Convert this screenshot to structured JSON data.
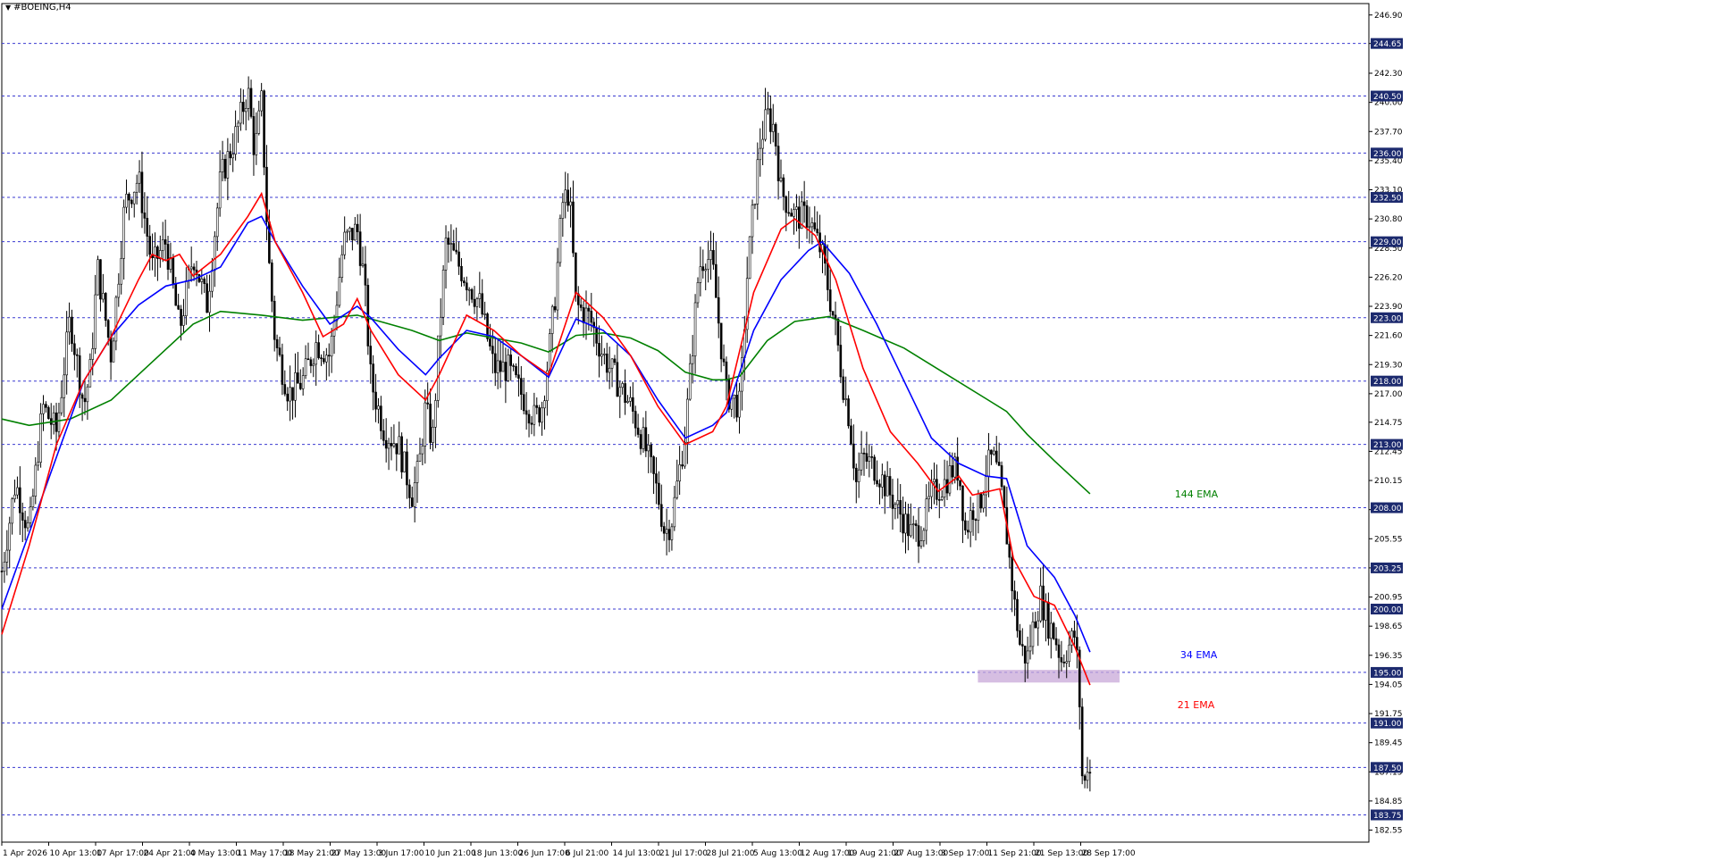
{
  "window": {
    "symbol_title": "#BOEING,H4",
    "menu_icon": "triangle-down-icon"
  },
  "chart_data": {
    "type": "candlestick",
    "title": "#BOEING,H4",
    "ylim": [
      181.6,
      247.8
    ],
    "y_ticks": [
      "246.90",
      "244.65",
      "242.30",
      "240.00",
      "237.70",
      "235.40",
      "233.10",
      "230.80",
      "228.50",
      "226.20",
      "223.90",
      "221.60",
      "219.30",
      "217.00",
      "214.75",
      "212.45",
      "210.15",
      "207.85",
      "205.55",
      "203.25",
      "200.95",
      "198.65",
      "196.35",
      "194.05",
      "191.75",
      "189.45",
      "187.15",
      "184.85",
      "182.55"
    ],
    "x_ticks": [
      "1 Apr 2026",
      "10 Apr 13:00",
      "17 Apr 17:00",
      "24 Apr 21:00",
      "4 May 13:00",
      "11 May 17:00",
      "18 May 21:00",
      "27 May 13:00",
      "3 Jun 17:00",
      "10 Jun 21:00",
      "18 Jun 13:00",
      "26 Jun 17:00",
      "6 Jul 21:00",
      "14 Jul 13:00",
      "21 Jul 17:00",
      "28 Jul 21:00",
      "5 Aug 13:00",
      "12 Aug 17:00",
      "19 Aug 21:00",
      "27 Aug 13:00",
      "3 Sep 17:00",
      "11 Sep 21:00",
      "21 Sep 13:00",
      "28 Sep 17:00"
    ],
    "levels": [
      {
        "value": 244.65,
        "label": "244.65"
      },
      {
        "value": 240.5,
        "label": "240.50"
      },
      {
        "value": 236.0,
        "label": "236.00"
      },
      {
        "value": 232.5,
        "label": "232.50"
      },
      {
        "value": 229.0,
        "label": "229.00"
      },
      {
        "value": 223.0,
        "label": "223.00"
      },
      {
        "value": 218.0,
        "label": "218.00"
      },
      {
        "value": 213.0,
        "label": "213.00"
      },
      {
        "value": 208.0,
        "label": "208.00"
      },
      {
        "value": 203.25,
        "label": "203.25"
      },
      {
        "value": 200.0,
        "label": "200.00"
      },
      {
        "value": 195.0,
        "label": "195.00"
      },
      {
        "value": 191.0,
        "label": "191.00"
      },
      {
        "value": 187.5,
        "label": "187.50"
      },
      {
        "value": 183.75,
        "label": "183.75"
      }
    ],
    "highlight_zone": {
      "x_start": 0.714,
      "x_end": 0.8176,
      "y_low": 194.2,
      "y_high": 195.2
    },
    "ema_series": [
      {
        "name": "144 EMA",
        "color": "#008000",
        "points": [
          [
            0,
            215.0
          ],
          [
            0.02,
            214.5
          ],
          [
            0.05,
            215.0
          ],
          [
            0.08,
            216.5
          ],
          [
            0.1,
            218.5
          ],
          [
            0.12,
            220.5
          ],
          [
            0.14,
            222.5
          ],
          [
            0.16,
            223.5
          ],
          [
            0.19,
            223.2
          ],
          [
            0.22,
            222.8
          ],
          [
            0.26,
            223.2
          ],
          [
            0.28,
            222.6
          ],
          [
            0.3,
            222.0
          ],
          [
            0.32,
            221.2
          ],
          [
            0.34,
            221.8
          ],
          [
            0.36,
            221.4
          ],
          [
            0.38,
            221.0
          ],
          [
            0.4,
            220.3
          ],
          [
            0.42,
            221.6
          ],
          [
            0.44,
            221.8
          ],
          [
            0.46,
            221.4
          ],
          [
            0.48,
            220.4
          ],
          [
            0.5,
            218.7
          ],
          [
            0.52,
            218.1
          ],
          [
            0.53,
            218.1
          ],
          [
            0.54,
            218.4
          ],
          [
            0.56,
            221.2
          ],
          [
            0.58,
            222.7
          ],
          [
            0.605,
            223.1
          ],
          [
            0.63,
            222.0
          ],
          [
            0.66,
            220.6
          ],
          [
            0.69,
            218.6
          ],
          [
            0.72,
            216.6
          ],
          [
            0.735,
            215.6
          ],
          [
            0.75,
            213.8
          ],
          [
            0.77,
            211.7
          ],
          [
            0.796,
            209.1
          ]
        ]
      },
      {
        "name": "34 EMA",
        "color": "#0000ff",
        "points": [
          [
            0,
            200.0
          ],
          [
            0.02,
            206.0
          ],
          [
            0.04,
            212.0
          ],
          [
            0.06,
            218.0
          ],
          [
            0.08,
            221.5
          ],
          [
            0.1,
            224.0
          ],
          [
            0.12,
            225.5
          ],
          [
            0.14,
            226.0
          ],
          [
            0.16,
            227.0
          ],
          [
            0.18,
            230.5
          ],
          [
            0.19,
            231.0
          ],
          [
            0.2,
            229.0
          ],
          [
            0.22,
            225.5
          ],
          [
            0.24,
            222.5
          ],
          [
            0.26,
            223.9
          ],
          [
            0.27,
            223.0
          ],
          [
            0.29,
            220.5
          ],
          [
            0.31,
            218.5
          ],
          [
            0.32,
            219.8
          ],
          [
            0.34,
            222.0
          ],
          [
            0.36,
            221.5
          ],
          [
            0.38,
            220.0
          ],
          [
            0.4,
            218.3
          ],
          [
            0.42,
            222.9
          ],
          [
            0.44,
            222.0
          ],
          [
            0.46,
            220.0
          ],
          [
            0.48,
            216.5
          ],
          [
            0.5,
            213.5
          ],
          [
            0.52,
            214.5
          ],
          [
            0.53,
            215.5
          ],
          [
            0.55,
            222.0
          ],
          [
            0.57,
            226.0
          ],
          [
            0.59,
            228.3
          ],
          [
            0.6,
            229.0
          ],
          [
            0.62,
            226.5
          ],
          [
            0.64,
            222.5
          ],
          [
            0.66,
            218.0
          ],
          [
            0.68,
            213.5
          ],
          [
            0.7,
            211.5
          ],
          [
            0.72,
            210.5
          ],
          [
            0.735,
            210.3
          ],
          [
            0.75,
            205.0
          ],
          [
            0.77,
            202.5
          ],
          [
            0.785,
            199.5
          ],
          [
            0.796,
            196.6
          ]
        ]
      },
      {
        "name": "21 EMA",
        "color": "#ff0000",
        "points": [
          [
            0,
            198.0
          ],
          [
            0.02,
            205.0
          ],
          [
            0.04,
            213.0
          ],
          [
            0.06,
            218.0
          ],
          [
            0.08,
            221.5
          ],
          [
            0.1,
            226.0
          ],
          [
            0.11,
            228.0
          ],
          [
            0.12,
            227.5
          ],
          [
            0.13,
            228.0
          ],
          [
            0.14,
            226.3
          ],
          [
            0.16,
            228.0
          ],
          [
            0.18,
            231.0
          ],
          [
            0.19,
            232.8
          ],
          [
            0.2,
            229.0
          ],
          [
            0.22,
            225.0
          ],
          [
            0.235,
            221.5
          ],
          [
            0.25,
            222.5
          ],
          [
            0.26,
            224.5
          ],
          [
            0.27,
            222.0
          ],
          [
            0.29,
            218.5
          ],
          [
            0.31,
            216.5
          ],
          [
            0.32,
            218.5
          ],
          [
            0.34,
            223.2
          ],
          [
            0.36,
            222.0
          ],
          [
            0.38,
            220.0
          ],
          [
            0.4,
            218.5
          ],
          [
            0.42,
            225.0
          ],
          [
            0.44,
            223.0
          ],
          [
            0.46,
            220.0
          ],
          [
            0.48,
            216.0
          ],
          [
            0.5,
            213.0
          ],
          [
            0.52,
            214.0
          ],
          [
            0.53,
            216.0
          ],
          [
            0.55,
            225.0
          ],
          [
            0.57,
            230.0
          ],
          [
            0.58,
            230.8
          ],
          [
            0.595,
            229.5
          ],
          [
            0.61,
            226.0
          ],
          [
            0.63,
            219.0
          ],
          [
            0.65,
            214.0
          ],
          [
            0.67,
            211.5
          ],
          [
            0.685,
            209.3
          ],
          [
            0.7,
            210.5
          ],
          [
            0.71,
            209.0
          ],
          [
            0.73,
            209.5
          ],
          [
            0.74,
            204.0
          ],
          [
            0.755,
            201.0
          ],
          [
            0.77,
            200.3
          ],
          [
            0.785,
            197.0
          ],
          [
            0.796,
            194.0
          ]
        ]
      }
    ],
    "ema_label_positions": [
      {
        "name": "144 EMA",
        "x": 0.858,
        "y": 209.0
      },
      {
        "name": "34 EMA",
        "x": 0.862,
        "y": 196.3
      },
      {
        "name": "21 EMA",
        "x": 0.86,
        "y": 192.4
      }
    ],
    "candle_anchors": [
      [
        0,
        203
      ],
      [
        0.01,
        210
      ],
      [
        0.02,
        206
      ],
      [
        0.03,
        216
      ],
      [
        0.04,
        214
      ],
      [
        0.05,
        223
      ],
      [
        0.06,
        216
      ],
      [
        0.065,
        219
      ],
      [
        0.07,
        227
      ],
      [
        0.08,
        220
      ],
      [
        0.09,
        232
      ],
      [
        0.1,
        234
      ],
      [
        0.11,
        227
      ],
      [
        0.12,
        229
      ],
      [
        0.13,
        222
      ],
      [
        0.14,
        228
      ],
      [
        0.15,
        224
      ],
      [
        0.16,
        234
      ],
      [
        0.17,
        237
      ],
      [
        0.175,
        239
      ],
      [
        0.18,
        241
      ],
      [
        0.185,
        236
      ],
      [
        0.19,
        240
      ],
      [
        0.195,
        228
      ],
      [
        0.2,
        221
      ],
      [
        0.21,
        217
      ],
      [
        0.22,
        218
      ],
      [
        0.23,
        221
      ],
      [
        0.24,
        220
      ],
      [
        0.25,
        229
      ],
      [
        0.26,
        230
      ],
      [
        0.265,
        226
      ],
      [
        0.27,
        218
      ],
      [
        0.28,
        214
      ],
      [
        0.29,
        213
      ],
      [
        0.3,
        209
      ],
      [
        0.305,
        211
      ],
      [
        0.31,
        216
      ],
      [
        0.315,
        213
      ],
      [
        0.32,
        222
      ],
      [
        0.325,
        229
      ],
      [
        0.33,
        228
      ],
      [
        0.34,
        226
      ],
      [
        0.35,
        224
      ],
      [
        0.36,
        219
      ],
      [
        0.37,
        219
      ],
      [
        0.38,
        217
      ],
      [
        0.39,
        215
      ],
      [
        0.395,
        216
      ],
      [
        0.4,
        220
      ],
      [
        0.405,
        225
      ],
      [
        0.41,
        232
      ],
      [
        0.415,
        233
      ],
      [
        0.42,
        224
      ],
      [
        0.43,
        223
      ],
      [
        0.44,
        220
      ],
      [
        0.45,
        218
      ],
      [
        0.46,
        216
      ],
      [
        0.47,
        213
      ],
      [
        0.48,
        209
      ],
      [
        0.485,
        206
      ],
      [
        0.49,
        207
      ],
      [
        0.5,
        214
      ],
      [
        0.51,
        227
      ],
      [
        0.515,
        228
      ],
      [
        0.52,
        227
      ],
      [
        0.53,
        217
      ],
      [
        0.54,
        216
      ],
      [
        0.545,
        226
      ],
      [
        0.55,
        232
      ],
      [
        0.555,
        237
      ],
      [
        0.56,
        239
      ],
      [
        0.565,
        238
      ],
      [
        0.57,
        233
      ],
      [
        0.58,
        231
      ],
      [
        0.59,
        231
      ],
      [
        0.6,
        228
      ],
      [
        0.605,
        225
      ],
      [
        0.61,
        222
      ],
      [
        0.615,
        218
      ],
      [
        0.62,
        215
      ],
      [
        0.625,
        210
      ],
      [
        0.63,
        212
      ],
      [
        0.64,
        211
      ],
      [
        0.65,
        209
      ],
      [
        0.66,
        207
      ],
      [
        0.665,
        206
      ],
      [
        0.67,
        206
      ],
      [
        0.675,
        207
      ],
      [
        0.68,
        209
      ],
      [
        0.69,
        210
      ],
      [
        0.695,
        211
      ],
      [
        0.7,
        211
      ],
      [
        0.705,
        206
      ],
      [
        0.71,
        208
      ],
      [
        0.715,
        208
      ],
      [
        0.72,
        211
      ],
      [
        0.725,
        212
      ],
      [
        0.73,
        210
      ],
      [
        0.735,
        206
      ],
      [
        0.74,
        201
      ],
      [
        0.745,
        197
      ],
      [
        0.75,
        196
      ],
      [
        0.755,
        199
      ],
      [
        0.76,
        201
      ],
      [
        0.765,
        199
      ],
      [
        0.77,
        198
      ],
      [
        0.775,
        196
      ],
      [
        0.78,
        197
      ],
      [
        0.785,
        198
      ],
      [
        0.788,
        194
      ],
      [
        0.79,
        187
      ],
      [
        0.792,
        186
      ],
      [
        0.794,
        188
      ],
      [
        0.796,
        187
      ]
    ]
  },
  "labels": {
    "ema144": "144 EMA",
    "ema34": "34 EMA",
    "ema21": "21 EMA"
  }
}
